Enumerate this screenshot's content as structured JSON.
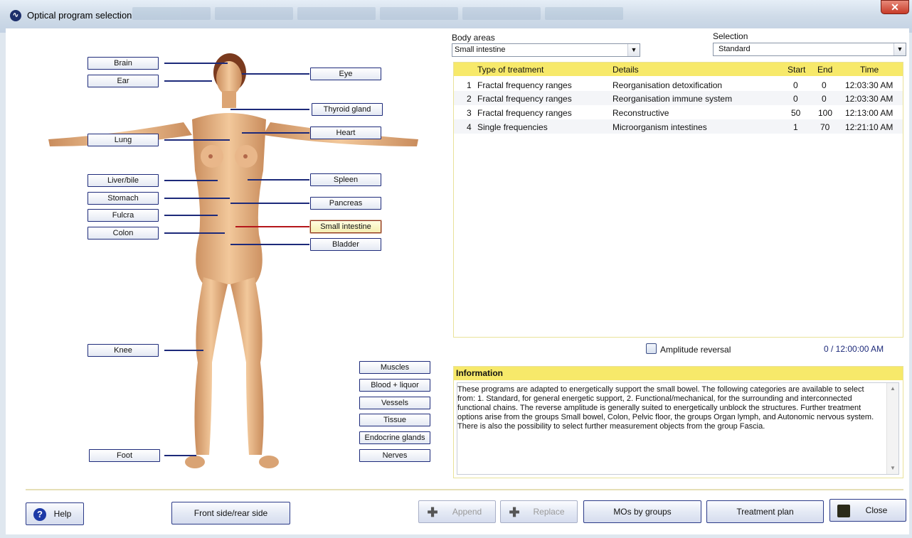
{
  "window": {
    "title": "Optical program selection",
    "close_glyph": "✕",
    "app_icon_glyph": "∿"
  },
  "organs": {
    "left": [
      "Brain",
      "Ear",
      "Lung",
      "Liver/bile",
      "Stomach",
      "Fulcra",
      "Colon",
      "Knee",
      "Foot"
    ],
    "right": [
      "Eye",
      "Thyroid gland",
      "Heart",
      "Spleen",
      "Pancreas",
      "Small intestine",
      "Bladder"
    ],
    "selected": "Small intestine"
  },
  "groups": [
    "Muscles",
    "Blood + liquor",
    "Vessels",
    "Tissue",
    "Endocrine glands",
    "Nerves"
  ],
  "body_areas": {
    "label": "Body areas",
    "value": "Small intestine"
  },
  "selection": {
    "label": "Selection",
    "value": "Standard"
  },
  "table": {
    "headers": [
      "Type of treatment",
      "Details",
      "Start",
      "End",
      "Time"
    ],
    "rows": [
      {
        "num": "1",
        "type": "Fractal frequency ranges",
        "details": "Reorganisation detoxification",
        "start": "0",
        "end": "0",
        "time": "12:03:30 AM"
      },
      {
        "num": "2",
        "type": "Fractal frequency ranges",
        "details": "Reorganisation immune system",
        "start": "0",
        "end": "0",
        "time": "12:03:30 AM"
      },
      {
        "num": "3",
        "type": "Fractal frequency ranges",
        "details": "Reconstructive",
        "start": "50",
        "end": "100",
        "time": "12:13:00 AM"
      },
      {
        "num": "4",
        "type": "Single frequencies",
        "details": "Microorganism intestines",
        "start": "1",
        "end": "70",
        "time": "12:21:10 AM"
      }
    ]
  },
  "amplitude": {
    "label": "Amplitude reversal",
    "checked": false,
    "counter": "0  / 12:00:00 AM"
  },
  "information": {
    "title": "Information",
    "text": "These programs are adapted to energetically support the small bowel. The following categories are available to select from: 1. Standard, for general energetic support, 2. Functional/mechanical, for the surrounding and interconnected functional chains. The reverse amplitude is generally suited to energetically unblock the structures. Further treatment options arise from the groups Small bowel, Colon, Pelvic floor, the groups Organ lymph, and Autonomic nervous system. There is also the possibility to select further measurement objects from the group Fascia."
  },
  "buttons": {
    "help": "Help",
    "front_rear": "Front side/rear side",
    "append": "Append",
    "replace": "Replace",
    "mos_by_groups": "MOs by groups",
    "treatment_plan": "Treatment plan",
    "close": "Close"
  },
  "colors": {
    "accent_header": "#f7e96a",
    "button_border": "#1d2a7a",
    "selected_line": "#b5161a",
    "leader_line": "#1d2a7a",
    "skin": "#e7b98a"
  }
}
